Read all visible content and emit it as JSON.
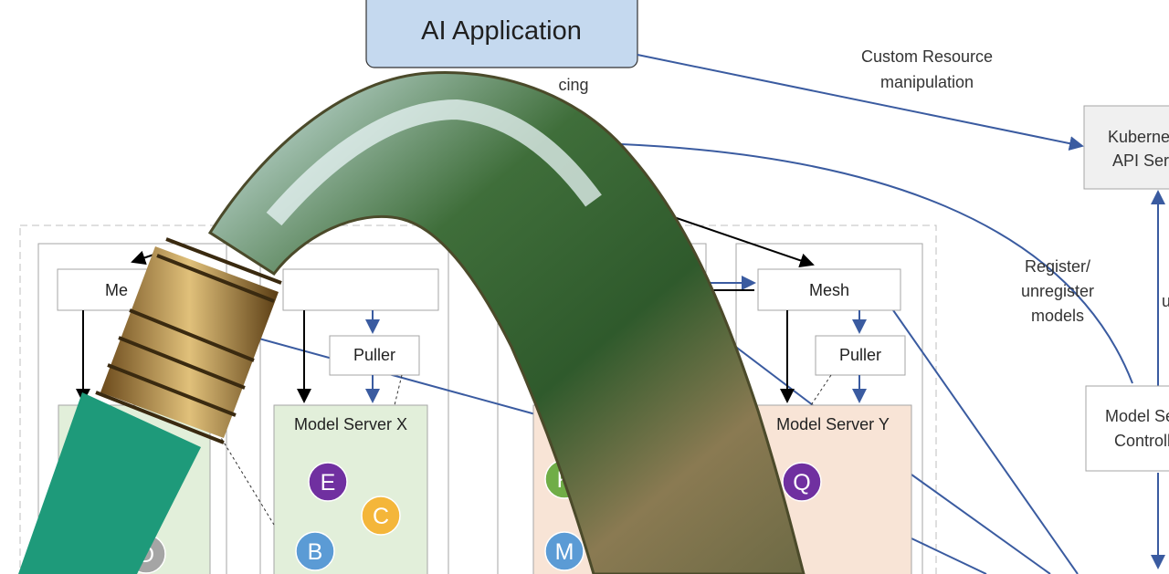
{
  "diagram": {
    "ai_app": "AI Application",
    "partial_label": "cing",
    "custom_resource": [
      "Custom Resource",
      "manipulation"
    ],
    "kube_api": [
      "Kubernetes",
      "API Server"
    ],
    "register": [
      "Register/",
      "unregister",
      "models"
    ],
    "right_partial": "u",
    "controller": [
      "Model Serving",
      "Controller"
    ],
    "mesh_partial": "Me",
    "mesh": "Mesh",
    "puller": "Puller",
    "model_server_x": "Model Server X",
    "model_server_y": "Model Server Y",
    "models": [
      {
        "label": "E",
        "color": "#7030a0"
      },
      {
        "label": "C",
        "color": "#f4b63a"
      },
      {
        "label": "B",
        "color": "#5b9bd5"
      },
      {
        "label": "D",
        "color": "#a5a5a5"
      },
      {
        "label": "K",
        "color": "#70ad47"
      },
      {
        "label": "M",
        "color": "#5b9bd5"
      },
      {
        "label": "Q",
        "color": "#7030a0"
      }
    ],
    "colors": {
      "arrow_blue": "#3a5ba0",
      "green_box": "#e2efda",
      "orange_box": "#f8e4d6",
      "app_box": "#c5d9ef"
    }
  },
  "overlay": {
    "description_icons": [
      "garden-hose-icon",
      "water-stream-icon"
    ]
  }
}
